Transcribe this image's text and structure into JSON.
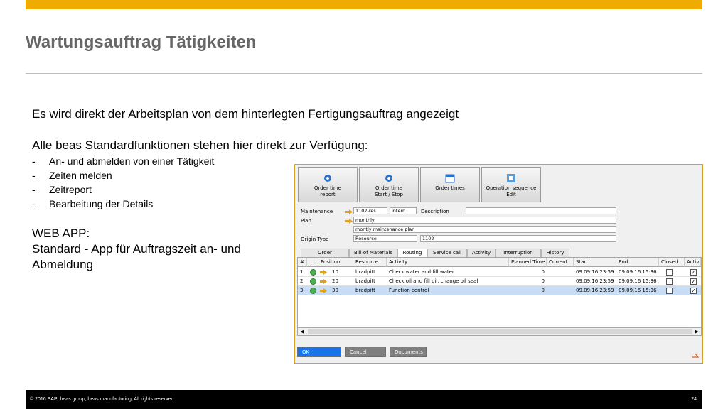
{
  "title": "Wartungsauftrag Tätigkeiten",
  "intro": "Es wird direkt der Arbeitsplan von dem hinterlegten Fertigungsauftrag angezeigt",
  "functions_heading": "Alle beas Standardfunktionen stehen hier direkt zur Verfügung:",
  "bullets": [
    "An- und abmelden von einer Tätigkeit",
    "Zeiten melden",
    "Zeitreport",
    "Bearbeitung der Details"
  ],
  "web_app": {
    "line1": "WEB APP:",
    "line2": "Standard - App für Auftragszeit an- und",
    "line3": "Abmeldung"
  },
  "app": {
    "toolbar": [
      {
        "line1": "Order time",
        "line2": "report",
        "icon": "gear-icon"
      },
      {
        "line1": "Order time",
        "line2": "Start / Stop",
        "icon": "gear-icon"
      },
      {
        "line1": "Order times",
        "line2": "",
        "icon": "calendar-icon"
      },
      {
        "line1": "Operation sequence",
        "line2": "Edit",
        "icon": "edit-icon"
      }
    ],
    "form": {
      "maintenance_label": "Maintenance",
      "maintenance_value": "1102-res",
      "maintenance_type": "intern",
      "description_label": "Description",
      "description_value": "",
      "plan_label": "Plan",
      "plan_value": "monthly",
      "plan_desc": "montly maintenance plan",
      "origin_label": "Origin Type",
      "origin_value": "Resource",
      "origin_code": "1102"
    },
    "tabs": [
      "Order",
      "Bill of Materials",
      "Routing",
      "Service call",
      "Activity",
      "Interruption",
      "History"
    ],
    "active_tab": "Routing",
    "columns": [
      "#",
      "...",
      "Position",
      "Resource",
      "Activity",
      "Planned Time",
      "Current",
      "Start",
      "End",
      "Closed",
      "Activ"
    ],
    "rows": [
      {
        "num": "1",
        "position": "10",
        "resource": "bradpitt",
        "activity": "Check water and fill water",
        "planned": "0",
        "start": "09.09.16 23:59",
        "end": "09.09.16 15:36",
        "closed": false,
        "active": true
      },
      {
        "num": "2",
        "position": "20",
        "resource": "bradpitt",
        "activity": "Check oil and fill oil, change oil seal",
        "planned": "0",
        "start": "09.09.16 23:59",
        "end": "09.09.16 15:36",
        "closed": false,
        "active": true
      },
      {
        "num": "3",
        "position": "30",
        "resource": "bradpitt",
        "activity": "Function control",
        "planned": "0",
        "start": "09.09.16 23:59",
        "end": "09.09.16 15:36",
        "closed": false,
        "active": true
      }
    ],
    "buttons": {
      "ok": "OK",
      "cancel": "Cancel",
      "documents": "Documents"
    },
    "colors": {
      "ok": "#1a73e8",
      "cancel": "#7f7f7f",
      "documents": "#7f7f7f",
      "border": "#d8a021",
      "selected_row": "#c7dcf5"
    }
  },
  "footer": {
    "copyright": "© 2016 SAP; beas group, beas manufacturing,  All rights reserved.",
    "page": "24"
  },
  "colors": {
    "accent_bar": "#f0ab00",
    "title": "#666666"
  }
}
